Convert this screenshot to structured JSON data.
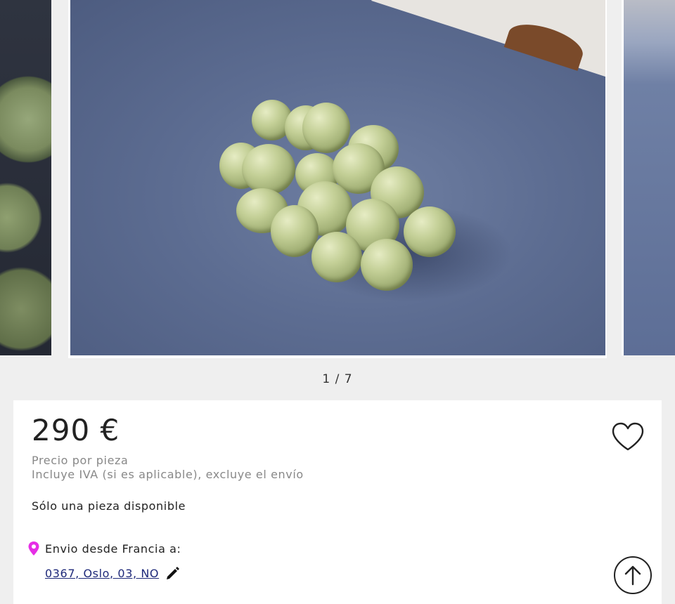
{
  "gallery": {
    "counter": "1 / 7",
    "current": 1,
    "total": 7
  },
  "product": {
    "price": "290 €",
    "price_unit": "Precio por pieza",
    "tax_note": "Incluye IVA (si es aplicable), excluye el envío",
    "availability": "Sólo una pieza disponible",
    "shipping_from": "Envio desde Francia a:",
    "shipping_address": "0367, Oslo, 03, NO"
  },
  "icons": {
    "favorite": "heart-icon",
    "location": "location-pin-icon",
    "edit": "pencil-icon",
    "scroll_top": "arrow-up-icon"
  },
  "colors": {
    "pin": "#e62ee6",
    "link": "#1f2a7a",
    "muted_text": "#888888",
    "page_background": "#efefef"
  }
}
